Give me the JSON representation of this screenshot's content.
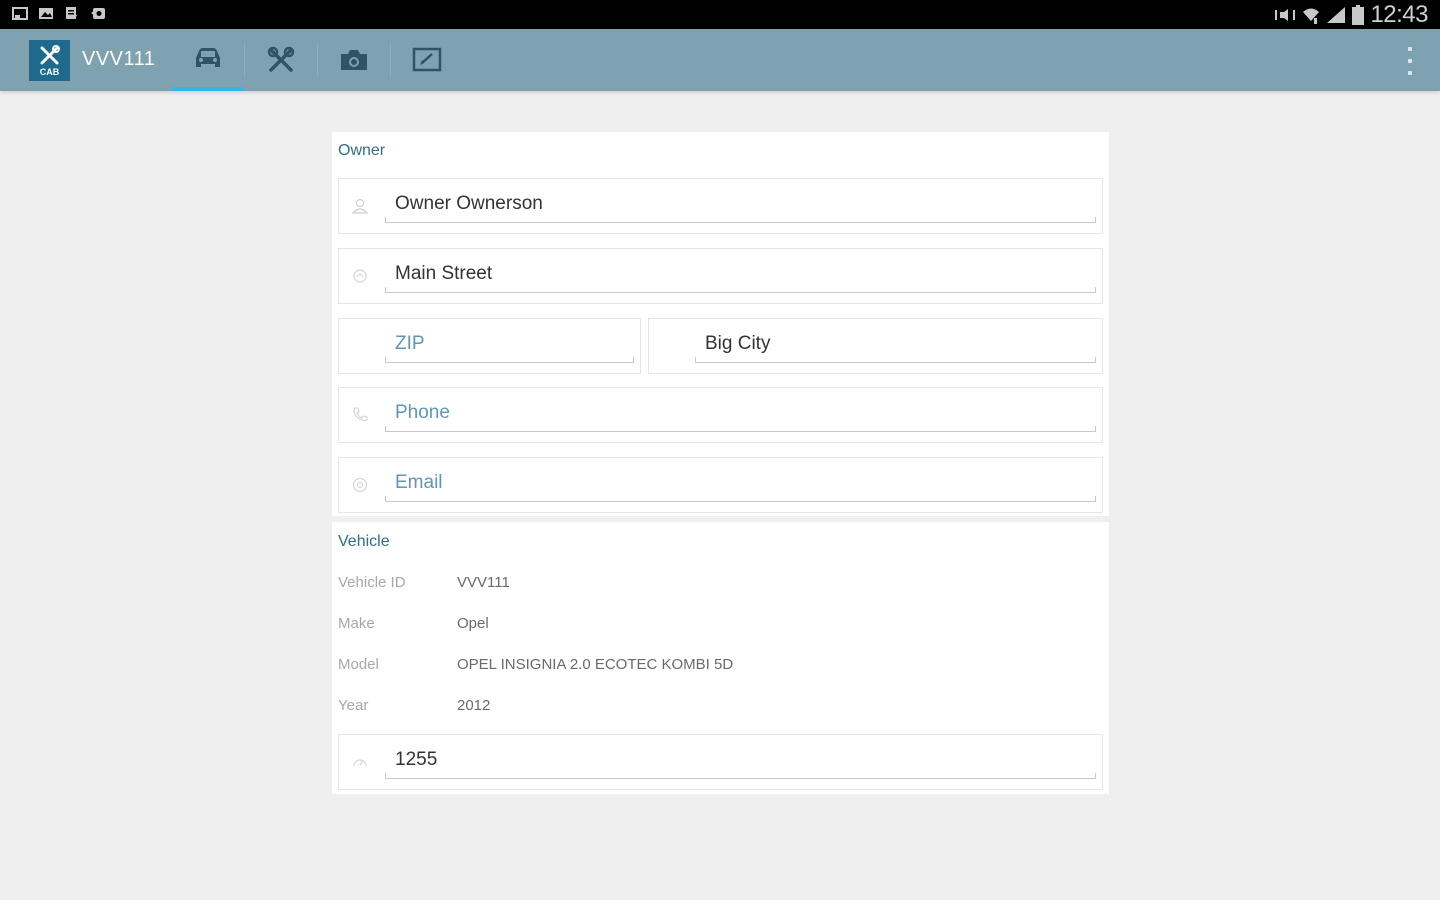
{
  "status_bar": {
    "left_icons": [
      "screenshot-icon",
      "gallery-icon",
      "download-icon",
      "sync-icon"
    ],
    "right_icons": [
      "mute-icon",
      "wifi-icon",
      "signal-icon",
      "battery-icon"
    ],
    "time": "12:43"
  },
  "action_bar": {
    "app_logo_text": "CAB",
    "title": "VVV111",
    "tabs": [
      {
        "icon": "car-icon",
        "active": true
      },
      {
        "icon": "tools-icon",
        "active": false
      },
      {
        "icon": "camera-icon",
        "active": false
      },
      {
        "icon": "edit-icon",
        "active": false
      }
    ],
    "overflow_icon": "overflow-menu-icon",
    "background_color": "#7ea2b0",
    "active_tab_indicator_color": "#33b5e5"
  },
  "owner": {
    "section_title": "Owner",
    "name": {
      "icon": "person-icon",
      "value": "Owner Ownerson"
    },
    "street": {
      "icon": "home-icon",
      "value": "Main Street"
    },
    "zip": {
      "placeholder": "ZIP"
    },
    "city": {
      "value": "Big City"
    },
    "phone": {
      "icon": "phone-icon",
      "placeholder": "Phone"
    },
    "email": {
      "icon": "email-icon",
      "placeholder": "Email"
    }
  },
  "vehicle": {
    "section_title": "Vehicle",
    "rows": [
      {
        "label": "Vehicle ID",
        "value": "VVV111"
      },
      {
        "label": "Make",
        "value": "Opel"
      },
      {
        "label": "Model",
        "value": "OPEL INSIGNIA 2.0 ECOTEC KOMBI 5D"
      },
      {
        "label": "Year",
        "value": "2012"
      }
    ],
    "mileage": {
      "icon": "speedometer-icon",
      "value": "1255"
    }
  }
}
